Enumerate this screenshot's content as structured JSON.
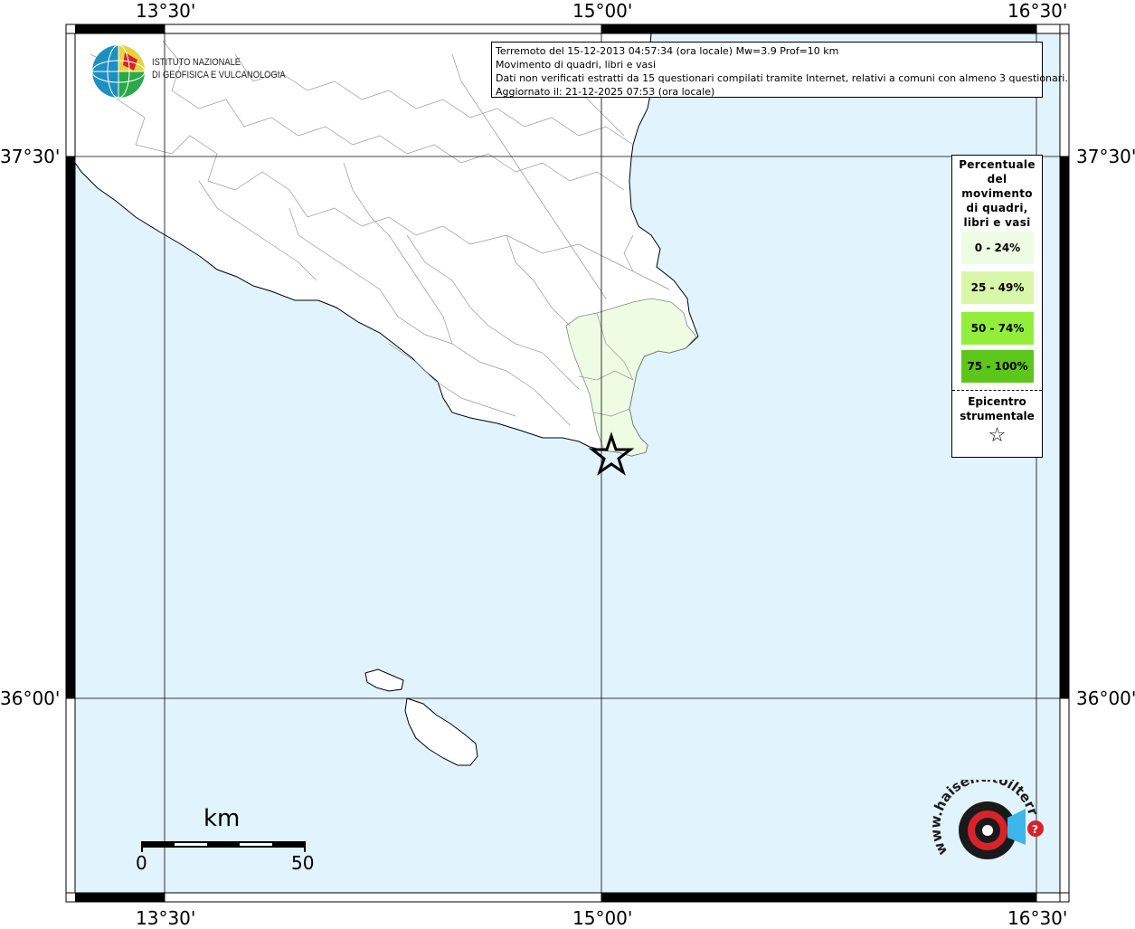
{
  "info": {
    "line1": "Terremoto del 15-12-2013 04:57:34 (ora locale) Mw=3.9 Prof=10 km",
    "line2": "Movimento di quadri, libri e vasi",
    "line3": "Dati non verificati estratti da 15 questionari compilati tramite Internet, relativi a comuni con almeno 3 questionari.",
    "line4": "Aggiornato il: 21-12-2025 07:53 (ora locale)"
  },
  "legend": {
    "title": "Percentuale\ndel\nmovimento\ndi quadri,\nlibri e vasi",
    "classes": [
      {
        "label": "0 - 24%",
        "color": "#eefce4"
      },
      {
        "label": "25 - 49%",
        "color": "#d8f7a8"
      },
      {
        "label": "50 - 74%",
        "color": "#93ee3b"
      },
      {
        "label": "75 - 100%",
        "color": "#5cc71a"
      }
    ],
    "epicenter_label": "Epicentro\nstrumentale",
    "epicenter_symbol": "☆"
  },
  "axes": {
    "lon_ticks": [
      "13°30'",
      "15°00'",
      "16°30'"
    ],
    "lat_ticks": [
      "37°30'",
      "36°00'"
    ]
  },
  "logo": {
    "line1": "ISTITUTO NAZIONALE",
    "line2": "DI GEOFISICA E VULCANOLOGIA",
    "site": "www.haisentitoilterremoto.it"
  },
  "scale": {
    "unit": "km",
    "min": "0",
    "max": "50"
  },
  "colors": {
    "sea": "#e1f3fd",
    "land": "#ffffff",
    "affected": "#eefce4",
    "border": "#999999"
  }
}
